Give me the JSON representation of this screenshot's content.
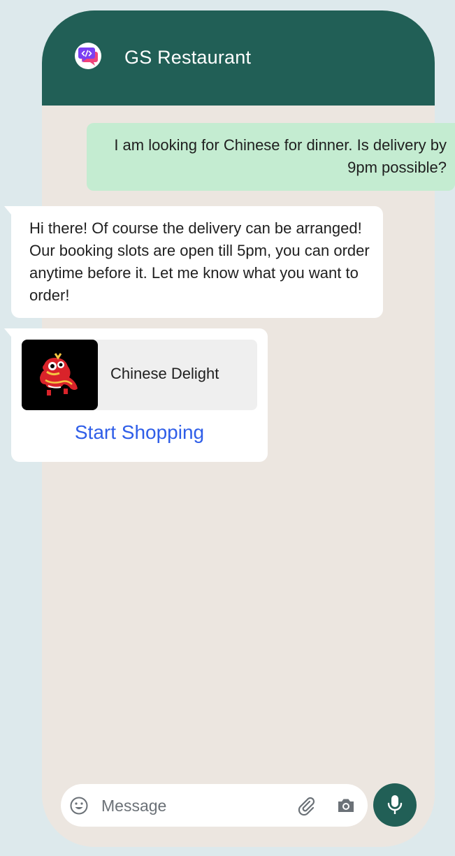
{
  "header": {
    "title": "GS Restaurant",
    "app_icon": "chat-code-logo-icon",
    "background": "#215f56"
  },
  "messages": [
    {
      "direction": "outgoing",
      "text": "I am looking for Chinese for dinner. Is delivery by 9pm possible?",
      "background": "#c4ecd1"
    },
    {
      "direction": "incoming",
      "text": "Hi there! Of course the delivery can be arranged! Our booking slots are open till 5pm, you can order anytime before it. Let me know what you want to order!",
      "background": "#ffffff"
    },
    {
      "direction": "incoming",
      "product": {
        "name": "Chinese Delight",
        "thumbnail": "lion-dance-image"
      },
      "cta_label": "Start Shopping",
      "cta_color": "#2f5ee8"
    }
  ],
  "composer": {
    "placeholder": "Message",
    "icons": [
      "emoji-icon",
      "attachment-icon",
      "camera-icon",
      "microphone-icon"
    ]
  }
}
